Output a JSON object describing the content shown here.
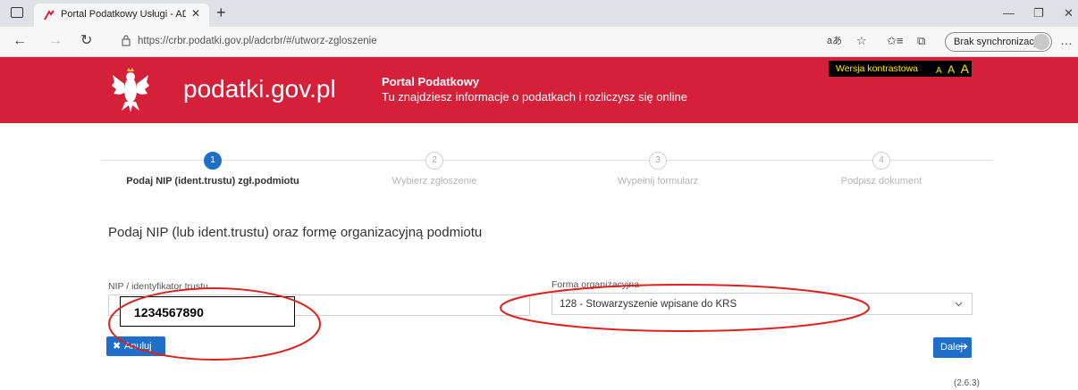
{
  "browser": {
    "tab_title": "Portal Podatkowy Usługi - ADCR",
    "url": "https://crbr.podatki.gov.pl/adcrbr/#/utworz-zgloszenie",
    "sync_label": "Brak synchronizacji"
  },
  "header": {
    "logo_text": "podatki.gov.pl",
    "portal_title": "Portal Podatkowy",
    "portal_subtitle": "Tu znajdziesz informacje o podatkach i rozliczysz się online",
    "contrast_label": "Wersja kontrastowa",
    "font_sizes": [
      "A",
      "A",
      "A"
    ]
  },
  "steps": [
    {
      "number": "1",
      "label": "Podaj NIP (ident.trustu) zgł.podmiotu",
      "active": true
    },
    {
      "number": "2",
      "label": "Wybierz zgłoszenie",
      "active": false
    },
    {
      "number": "3",
      "label": "Wypełnij formularz",
      "active": false
    },
    {
      "number": "4",
      "label": "Podpisz dokument",
      "active": false
    }
  ],
  "form": {
    "heading": "Podaj NIP (lub ident.trustu) oraz formę organizacyjną podmiotu",
    "nip_label": "NIP / identyfikator trustu",
    "nip_value": "1234567890",
    "org_label": "Forma organizacyjna",
    "org_value": "128 - Stowarzyszenie wpisane do KRS",
    "cancel_label": "Anuluj",
    "next_label": "Dalej"
  },
  "footer": {
    "version": "(2.6.3)"
  },
  "colors": {
    "header_red": "#d5203a",
    "primary_blue": "#1f6ec9",
    "annotation_red": "#e0201b",
    "contrast_yellow": "#ffe400"
  }
}
